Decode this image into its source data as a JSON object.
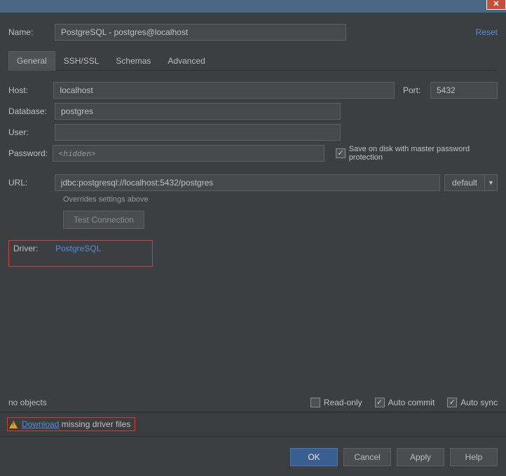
{
  "labels": {
    "name": "Name:",
    "host": "Host:",
    "port": "Port:",
    "database": "Database:",
    "user": "User:",
    "password": "Password:",
    "url": "URL:",
    "driver": "Driver:"
  },
  "name": "PostgreSQL - postgres@localhost",
  "reset": "Reset",
  "tabs": {
    "general": "General",
    "sshssl": "SSH/SSL",
    "schemas": "Schemas",
    "advanced": "Advanced"
  },
  "general": {
    "host": "localhost",
    "port": "5432",
    "database": "postgres",
    "user": "",
    "password_placeholder": "<hidden>",
    "save_pw": "Save on disk with master password protection",
    "url": "jdbc:postgresql://localhost:5432/postgres",
    "url_mode": "default",
    "url_hint": "Overrides settings above",
    "test_conn": "Test Connection",
    "driver_link": "PostgreSQL"
  },
  "bottom": {
    "status": "no objects",
    "read_only": "Read-only",
    "auto_commit": "Auto commit",
    "auto_sync": "Auto sync"
  },
  "download": {
    "link": "Download",
    "rest": " missing driver files"
  },
  "buttons": {
    "ok": "OK",
    "cancel": "Cancel",
    "apply": "Apply",
    "help": "Help"
  }
}
